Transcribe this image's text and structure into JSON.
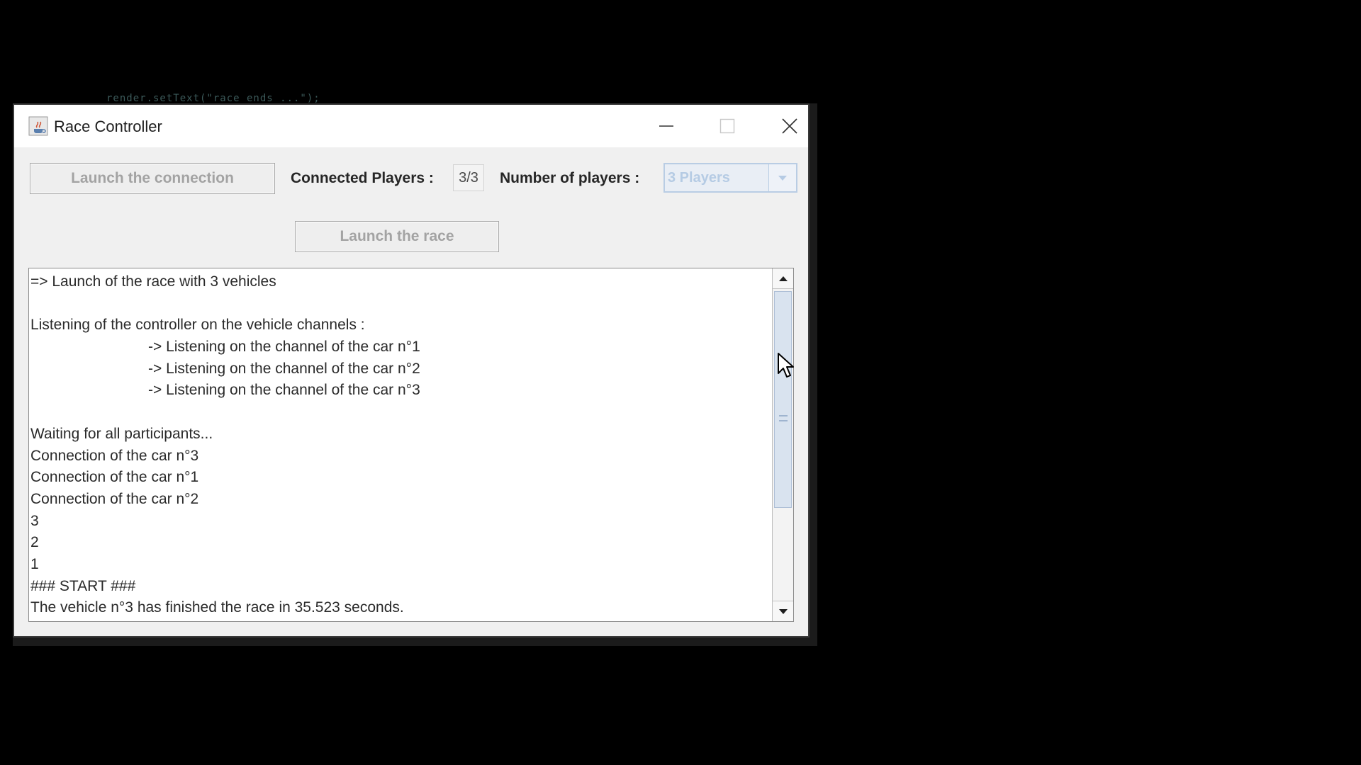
{
  "background": {
    "code_fragment": "render.setText(\"race ends ...\");"
  },
  "window": {
    "title": "Race Controller",
    "controls": {
      "minimize": "minimize-icon",
      "maximize": "maximize-icon",
      "close": "close-icon"
    }
  },
  "toolbar": {
    "launch_connection_label": "Launch the connection",
    "connected_players_label": "Connected Players :",
    "connected_players_value": "3/3",
    "number_of_players_label": "Number of players :",
    "number_of_players_selected": "3 Players",
    "launch_race_label": "Launch the race"
  },
  "log": {
    "lines": [
      {
        "text": "=> Launch of the race with 3 vehicles",
        "indent": false
      },
      {
        "text": "",
        "indent": false
      },
      {
        "text": "Listening of the controller on the vehicle channels :",
        "indent": false
      },
      {
        "text": "-> Listening on the channel of the car n°1",
        "indent": true
      },
      {
        "text": "-> Listening on the channel of the car n°2",
        "indent": true
      },
      {
        "text": "-> Listening on the channel of the car n°3",
        "indent": true
      },
      {
        "text": "",
        "indent": false
      },
      {
        "text": "Waiting for all participants...",
        "indent": false
      },
      {
        "text": "Connection of the car n°3",
        "indent": false
      },
      {
        "text": "Connection of the car n°1",
        "indent": false
      },
      {
        "text": "Connection of the car n°2",
        "indent": false
      },
      {
        "text": "3",
        "indent": false
      },
      {
        "text": "2",
        "indent": false
      },
      {
        "text": "1",
        "indent": false
      },
      {
        "text": "### START ###",
        "indent": false
      },
      {
        "text": "The vehicle n°3 has finished the race in 35.523 seconds.",
        "indent": false
      }
    ]
  },
  "colors": {
    "disabled_text": "#a3a3a3",
    "combo_disabled": "#b5cbe4",
    "window_bg": "#f0f0f0"
  }
}
